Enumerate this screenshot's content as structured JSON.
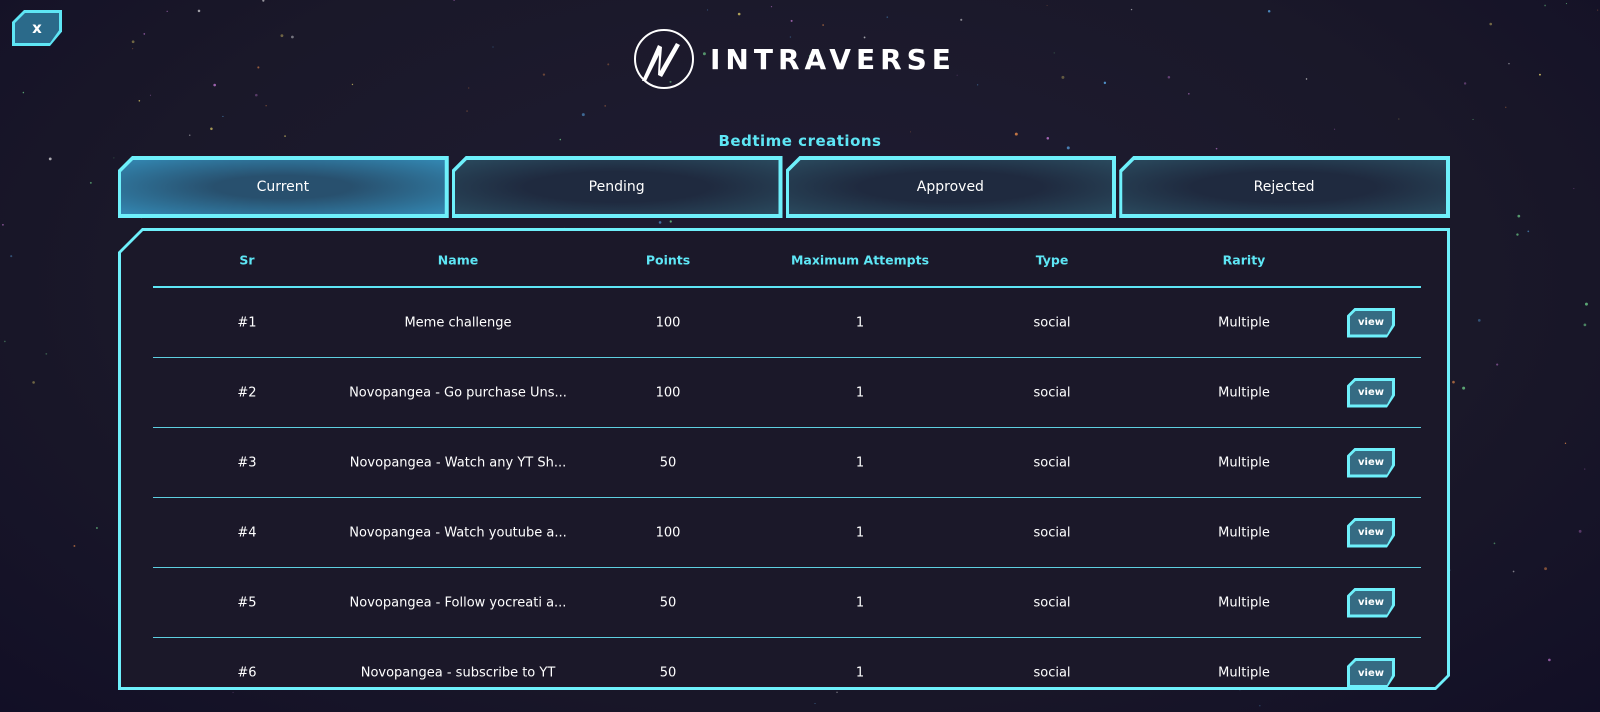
{
  "close_label": "x",
  "brand": "INTRAVERSE",
  "subtitle": "Bedtime creations",
  "tabs": [
    {
      "label": "Current"
    },
    {
      "label": "Pending"
    },
    {
      "label": "Approved"
    },
    {
      "label": "Rejected"
    }
  ],
  "active_tab": 0,
  "columns": [
    "Sr",
    "Name",
    "Points",
    "Maximum Attempts",
    "Type",
    "Rarity"
  ],
  "view_label": "view",
  "rows": [
    {
      "sr": "#1",
      "name": "Meme challenge",
      "points": "100",
      "attempts": "1",
      "type": "social",
      "rarity": "Multiple"
    },
    {
      "sr": "#2",
      "name": "Novopangea - Go purchase Uns...",
      "points": "100",
      "attempts": "1",
      "type": "social",
      "rarity": "Multiple"
    },
    {
      "sr": "#3",
      "name": "Novopangea - Watch any YT Sh...",
      "points": "50",
      "attempts": "1",
      "type": "social",
      "rarity": "Multiple"
    },
    {
      "sr": "#4",
      "name": "Novopangea - Watch youtube a...",
      "points": "100",
      "attempts": "1",
      "type": "social",
      "rarity": "Multiple"
    },
    {
      "sr": "#5",
      "name": "Novopangea - Follow yocreati a...",
      "points": "50",
      "attempts": "1",
      "type": "social",
      "rarity": "Multiple"
    },
    {
      "sr": "#6",
      "name": "Novopangea - subscribe to YT",
      "points": "50",
      "attempts": "1",
      "type": "social",
      "rarity": "Multiple"
    }
  ]
}
